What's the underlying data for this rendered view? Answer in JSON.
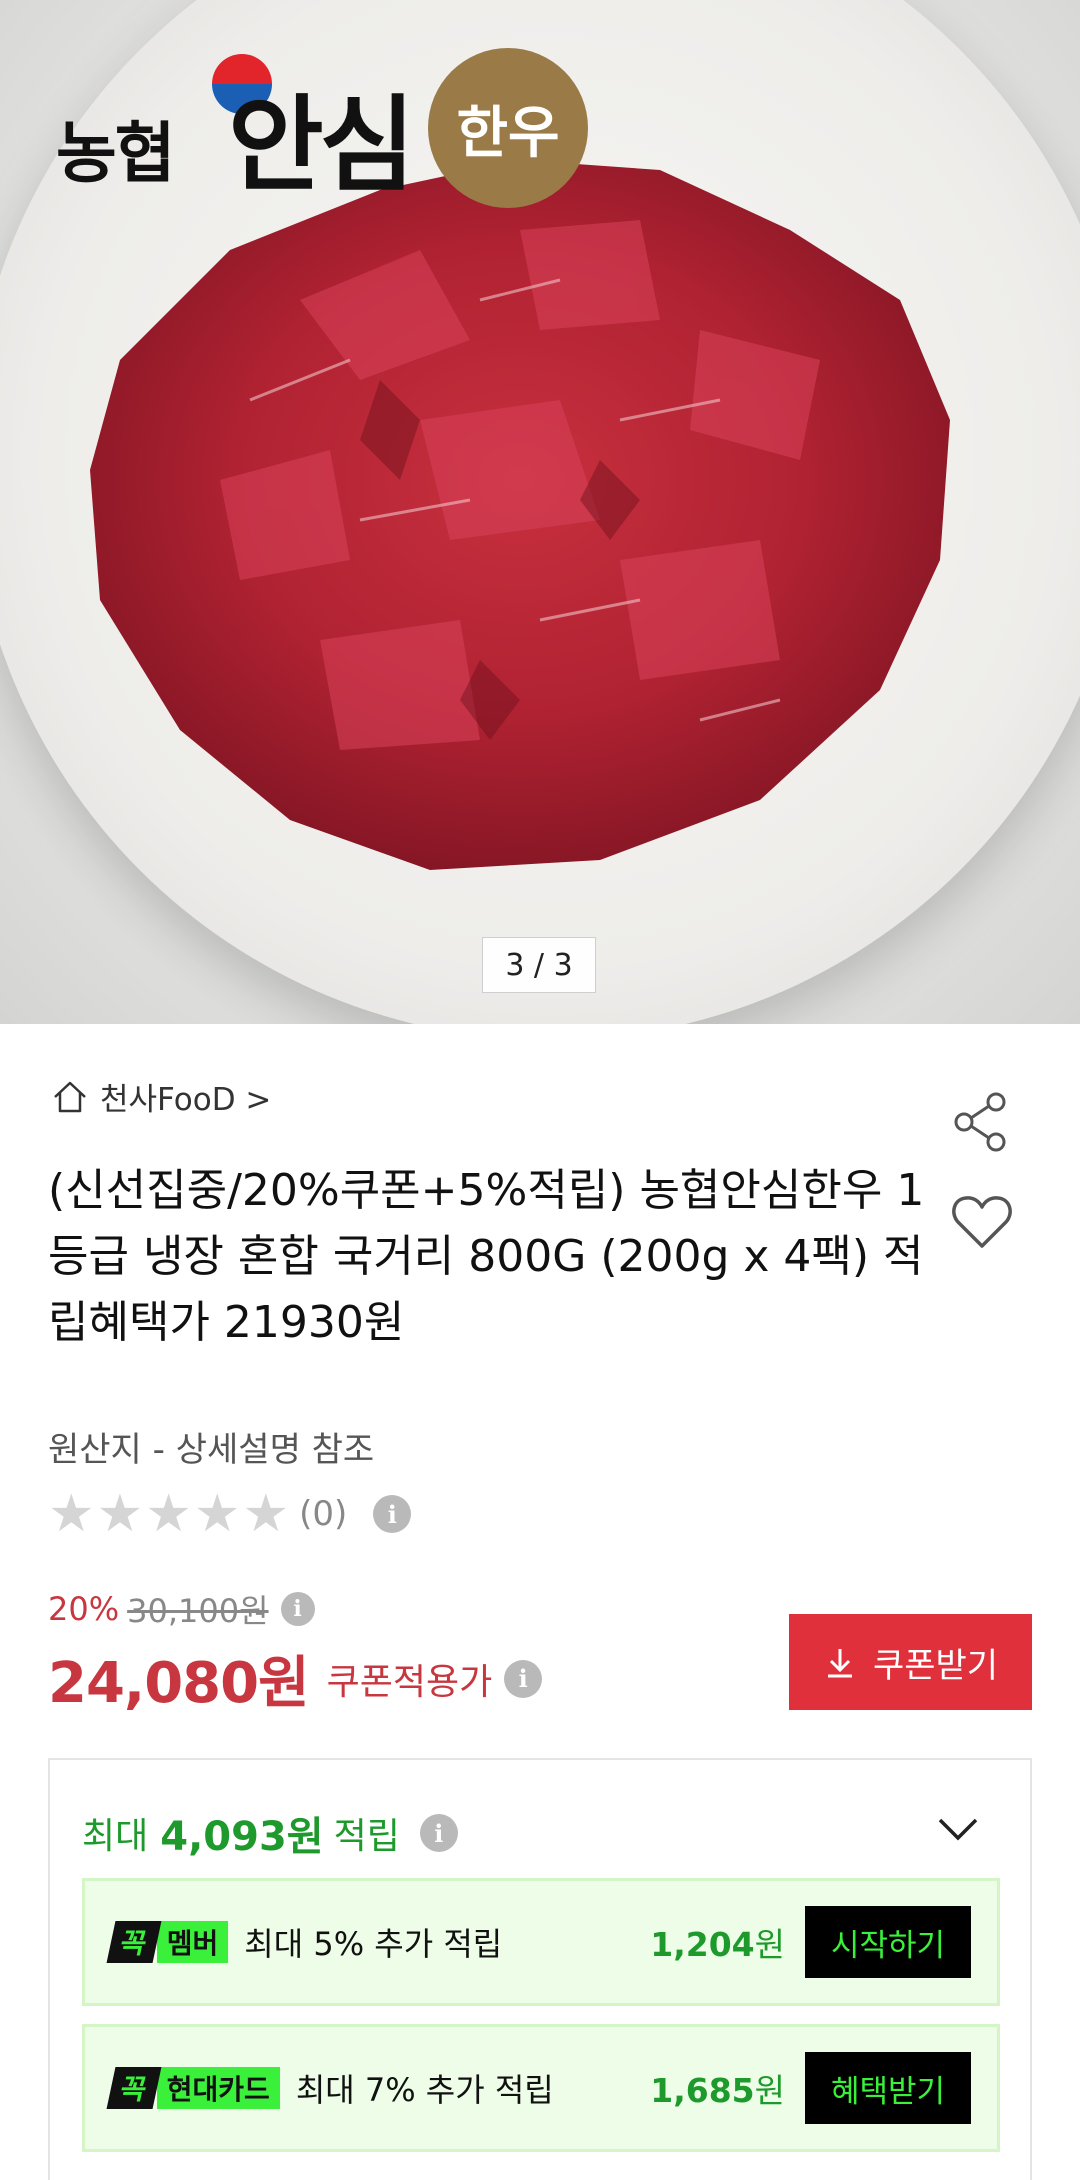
{
  "hero": {
    "counter": "3 / 3",
    "logo": {
      "part1": "농협",
      "part2": "안심",
      "badge": "한우"
    }
  },
  "product": {
    "store_name": "천사FooD >",
    "title": "(신선집중/20%쿠폰+5%적립) 농협안심한우 1등급 냉장 혼합 국거리 800G (200g x 4팩) 적립혜택가 21930원",
    "origin": "원산지 - 상세설명 참조",
    "rating_count": "(0)",
    "stars": 5,
    "rating_value": 0
  },
  "pricing": {
    "discount_rate": "20%",
    "original_price": "30,100원",
    "sale_price": "24,080원",
    "sale_label": "쿠폰적용가",
    "coupon_button": "쿠폰받기"
  },
  "rewards": {
    "prefix": "최대",
    "amount": "4,093원",
    "suffix": "적립",
    "benefits": [
      {
        "tag_prefix": "꼭",
        "tag_name": "멤버",
        "text": "최대 5% 추가 적립",
        "amount": "1,204",
        "unit": "원",
        "button": "시작하기"
      },
      {
        "tag_prefix": "꼭",
        "tag_name": "현대카드",
        "text": "최대 7% 추가 적립",
        "amount": "1,685",
        "unit": "원",
        "button": "혜택받기"
      }
    ]
  },
  "colors": {
    "accent_red": "#e0303c",
    "price_red": "#c8363f",
    "reward_green": "#1e9a2c",
    "tag_green": "#3bf03b"
  }
}
